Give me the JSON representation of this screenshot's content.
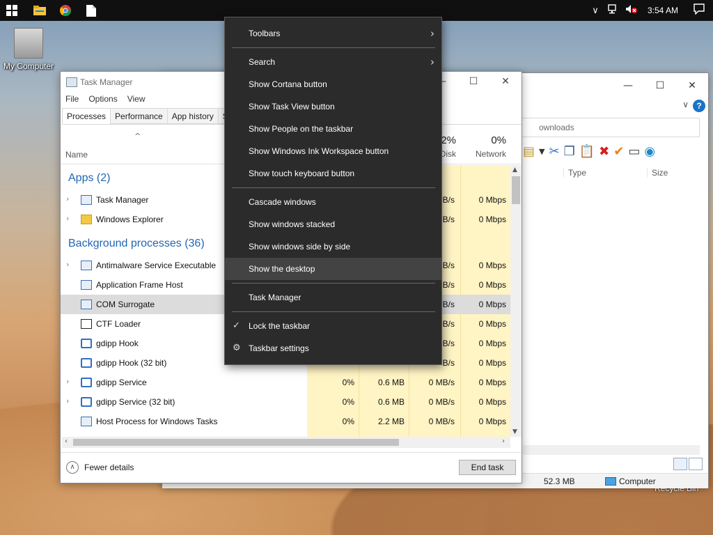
{
  "desktop": {
    "my_computer": "My Computer",
    "recycle_bin": "Recycle Bin"
  },
  "taskbar": {
    "start_icon": "windows-logo",
    "pinned_icons": [
      "file-explorer-icon",
      "chrome-icon",
      "document-icon"
    ],
    "tray_icons": [
      "chevron-up-icon",
      "network-icon",
      "volume-muted-icon"
    ],
    "time": "3:54 AM",
    "notification_icon": "action-center-icon"
  },
  "explorer": {
    "search_placeholder": "ownloads",
    "columns": [
      "Type",
      "Size"
    ],
    "status_size": "52.3 MB",
    "status_location": "Computer"
  },
  "task_manager": {
    "title": "Task Manager",
    "menu": [
      "File",
      "Options",
      "View"
    ],
    "tabs": [
      "Processes",
      "Performance",
      "App history",
      "Sta"
    ],
    "columns": {
      "name": "Name",
      "disk_pct": "2%",
      "disk": "Disk",
      "network_pct": "0%",
      "network": "Network"
    },
    "groups": {
      "apps": "Apps (2)",
      "background": "Background processes (36)"
    },
    "apps": [
      {
        "name": "Task Manager",
        "disk": "B/s",
        "network": "0 Mbps",
        "expandable": true
      },
      {
        "name": "Windows Explorer",
        "disk": "B/s",
        "network": "0 Mbps",
        "expandable": true
      }
    ],
    "background": [
      {
        "name": "Antimalware Service Executable",
        "cpu": "",
        "mem": "",
        "disk": "B/s",
        "network": "0 Mbps",
        "expandable": true
      },
      {
        "name": "Application Frame Host",
        "cpu": "",
        "mem": "",
        "disk": "B/s",
        "network": "0 Mbps",
        "expandable": false
      },
      {
        "name": "COM Surrogate",
        "cpu": "",
        "mem": "",
        "disk": "B/s",
        "network": "0 Mbps",
        "expandable": false
      },
      {
        "name": "CTF Loader",
        "cpu": "",
        "mem": "",
        "disk": "B/s",
        "network": "0 Mbps",
        "expandable": false
      },
      {
        "name": "gdipp Hook",
        "cpu": "",
        "mem": "",
        "disk": "B/s",
        "network": "0 Mbps",
        "expandable": false
      },
      {
        "name": "gdipp Hook (32 bit)",
        "cpu": "",
        "mem": "",
        "disk": "B/s",
        "network": "0 Mbps",
        "expandable": false
      },
      {
        "name": "gdipp Service",
        "cpu": "0%",
        "mem": "0.6 MB",
        "disk": "0 MB/s",
        "network": "0 Mbps",
        "expandable": true
      },
      {
        "name": "gdipp Service (32 bit)",
        "cpu": "0%",
        "mem": "0.6 MB",
        "disk": "0 MB/s",
        "network": "0 Mbps",
        "expandable": true
      },
      {
        "name": "Host Process for Windows Tasks",
        "cpu": "0%",
        "mem": "2.2 MB",
        "disk": "0 MB/s",
        "network": "0 Mbps",
        "expandable": false
      }
    ],
    "fewer_details": "Fewer details",
    "end_task": "End task"
  },
  "context_menu": {
    "items": [
      {
        "label": "Toolbars",
        "submenu": true
      },
      {
        "label": "Search",
        "submenu": true
      },
      {
        "label": "Show Cortana button"
      },
      {
        "label": "Show Task View button"
      },
      {
        "label": "Show People on the taskbar"
      },
      {
        "label": "Show Windows Ink Workspace button"
      },
      {
        "label": "Show touch keyboard button"
      },
      {
        "label": "Cascade windows"
      },
      {
        "label": "Show windows stacked"
      },
      {
        "label": "Show windows side by side"
      },
      {
        "label": "Show the desktop",
        "highlighted": true
      },
      {
        "label": "Task Manager"
      },
      {
        "label": "Lock the taskbar",
        "checked": true
      },
      {
        "label": "Taskbar settings",
        "icon": "gear-icon"
      }
    ]
  }
}
